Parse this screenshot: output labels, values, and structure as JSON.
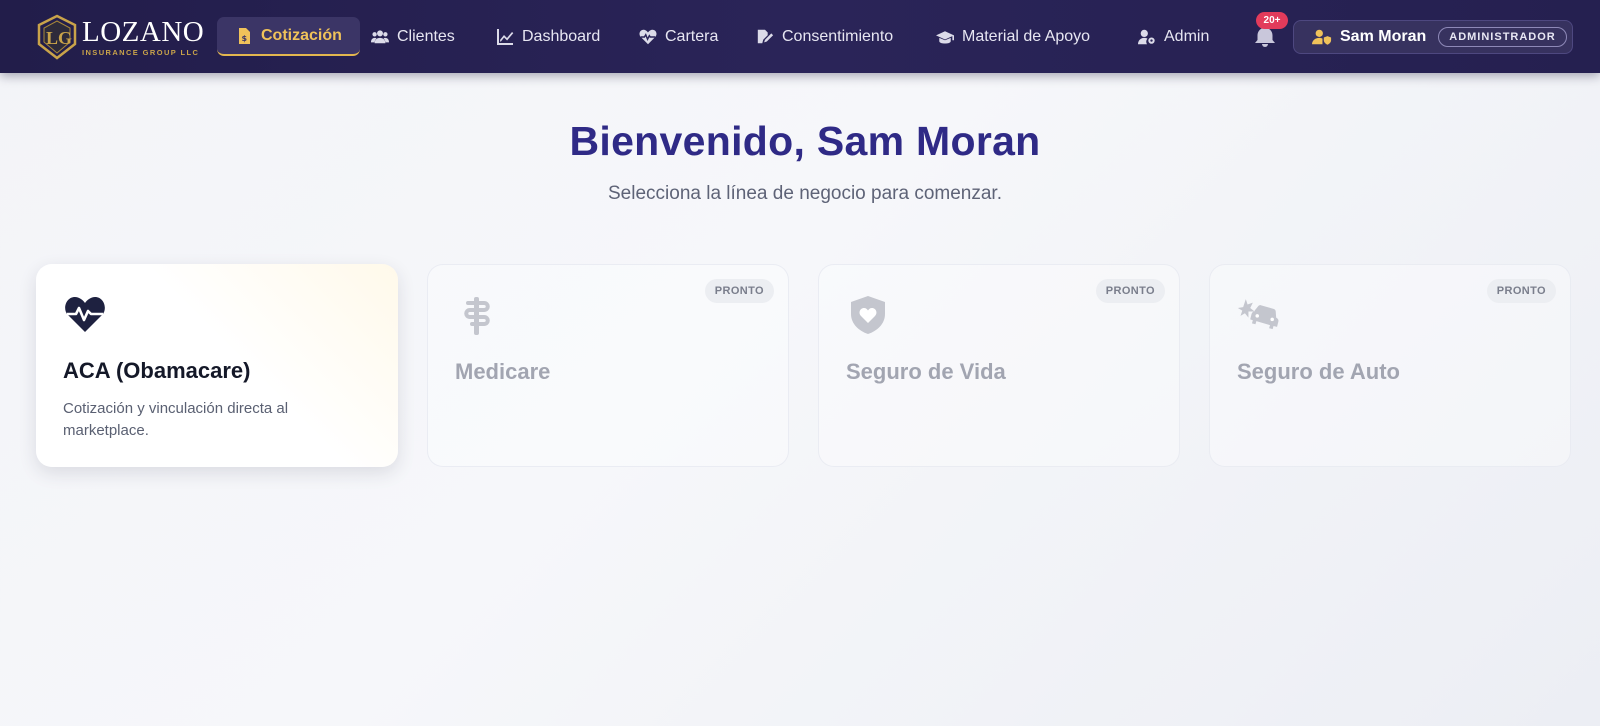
{
  "brand": {
    "name": "LOZANO",
    "subtitle": "INSURANCE GROUP LLC",
    "gold": "#c9a34a"
  },
  "nav": {
    "items": [
      {
        "label": "Cotización",
        "icon": "file-invoice-dollar-icon",
        "active": true
      },
      {
        "label": "Clientes",
        "icon": "users-icon"
      },
      {
        "label": "Dashboard",
        "icon": "chart-line-icon"
      },
      {
        "label": "Cartera",
        "icon": "heart-pulse-icon"
      },
      {
        "label": "Consentimiento",
        "icon": "file-signature-icon"
      },
      {
        "label": "Material de Apoyo",
        "icon": "graduation-cap-icon"
      },
      {
        "label": "Admin",
        "icon": "user-gear-icon"
      }
    ],
    "notifications": {
      "badge": "20+",
      "icon": "bell-icon"
    },
    "user": {
      "name": "Sam Moran",
      "role": "ADMINISTRADOR",
      "icon": "user-shield-icon"
    }
  },
  "hero": {
    "title": "Bienvenido, Sam Moran",
    "subtitle": "Selecciona la línea de negocio para comenzar."
  },
  "cards": [
    {
      "title": "ACA (Obamacare)",
      "description": "Cotización y vinculación directa al marketplace.",
      "icon": "heart-pulse-icon",
      "enabled": true
    },
    {
      "title": "Medicare",
      "badge": "PRONTO",
      "icon": "staff-snake-icon",
      "enabled": false
    },
    {
      "title": "Seguro de Vida",
      "badge": "PRONTO",
      "icon": "shield-heart-icon",
      "enabled": false
    },
    {
      "title": "Seguro de Auto",
      "badge": "PRONTO",
      "icon": "car-burst-icon",
      "enabled": false
    }
  ],
  "colors": {
    "nav_bg": "#221d4a",
    "accent_gold": "#f0c25a",
    "hero_title": "#2f2a86",
    "badge_red": "#e23b5b"
  }
}
